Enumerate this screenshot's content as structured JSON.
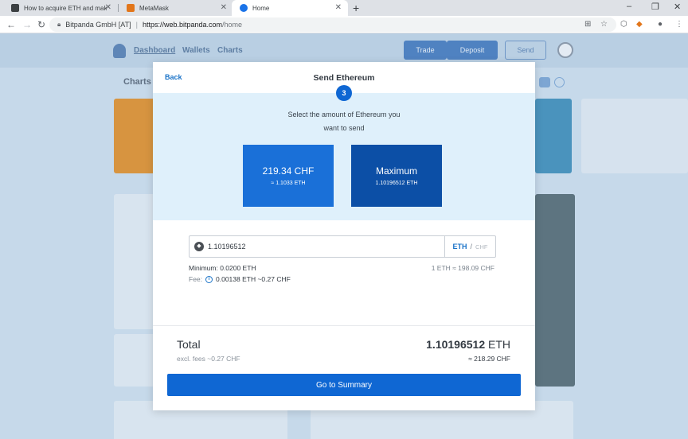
{
  "browser": {
    "tabs": [
      {
        "title": "How to acquire ETH and make a",
        "favicon_color": "#3c4043"
      },
      {
        "title": "MetaMask",
        "favicon_color": "#e2761b"
      },
      {
        "title": "Home",
        "favicon_color": "#1a73e8"
      }
    ],
    "new_tab_glyph": "+",
    "window_controls": [
      "–",
      "❐",
      "✕"
    ],
    "nav": {
      "back": "←",
      "forward": "→",
      "reload": "↻"
    },
    "address": {
      "org": "Bitpanda GmbH [AT]",
      "host": "https://web.bitpanda.com",
      "path": "/home"
    },
    "toolbar_icons": [
      "translate-icon",
      "star-icon",
      "extension-icon",
      "metamask-icon",
      "profile-icon",
      "menu-icon"
    ]
  },
  "background_page": {
    "nav": [
      "Dashboard",
      "Wallets",
      "Charts"
    ],
    "buttons": [
      "Trade",
      "Deposit",
      "Send"
    ],
    "section_title": "Charts"
  },
  "modal": {
    "back_label": "Back",
    "title": "Send Ethereum",
    "step": "3",
    "instruction_line1": "Select the amount of Ethereum you",
    "instruction_line2": "want to send",
    "option_fiat": {
      "amount": "219.34 CHF",
      "sub": "≈ 1.1033 ETH"
    },
    "option_max": {
      "label": "Maximum",
      "sub": "1.10196512 ETH"
    },
    "amount_input_value": "1.10196512",
    "unit_eth": "ETH",
    "unit_sep": "/",
    "unit_chf": "CHF",
    "minimum": "Minimum: 0.0200 ETH",
    "rate": "1 ETH ≈  198.09 CHF",
    "fee_label": "Fee:",
    "fee_value": "0.00138 ETH ~0.27 CHF",
    "total_label": "Total",
    "total_sub": "excl. fees ~0.27 CHF",
    "total_amount": "1.10196512",
    "total_unit": "ETH",
    "total_chf": "≈ 218.29 CHF",
    "cta_label": "Go to Summary"
  },
  "colors": {
    "primary": "#0f67d3",
    "dark_primary": "#0c4fa6",
    "light_zone": "#dff0fb"
  }
}
